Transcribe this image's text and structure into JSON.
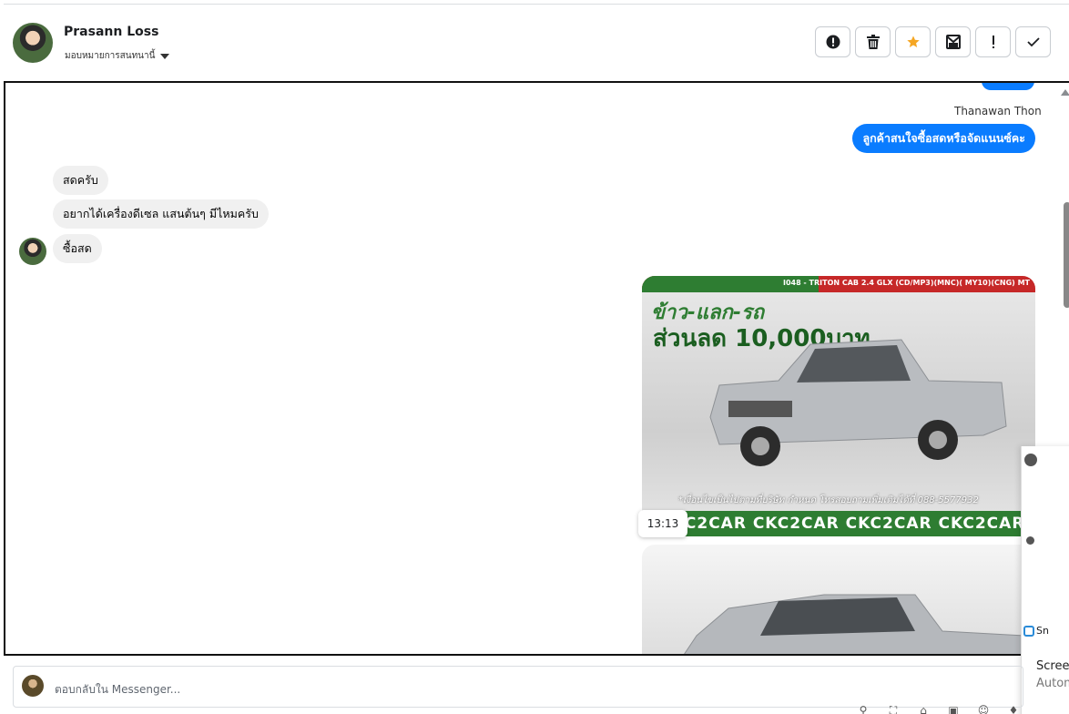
{
  "header": {
    "contact_name": "Prasann Loss",
    "assign_label": "มอบหมายการสนทนานี้",
    "actions": [
      {
        "icon": "alert-circle-icon"
      },
      {
        "icon": "trash-icon"
      },
      {
        "icon": "star-icon"
      },
      {
        "icon": "mark-unread-icon"
      },
      {
        "icon": "exclamation-icon"
      },
      {
        "icon": "check-icon"
      }
    ],
    "star_color": "#f5a623"
  },
  "conversation": {
    "sender_name": "Thanawan Thon",
    "outgoing_message": "ลูกค้าสนใจซื้อสดหรือจัดแนนซ์คะ",
    "incoming_messages": [
      "สดครับ",
      "อยากได้เครื่องดีเซล แสนต้นๆ มีไหมครับ",
      "ซื้อสด"
    ],
    "image_timestamp": "13:13",
    "image": {
      "model_text": "I048 - TRITON CAB 2.4 GLX (CD/MP3)(MNC)( MY10)(CNG) MT",
      "promo_line1": "ข้าว-แลก-รถ",
      "promo_line2": "ส่วนลด 10,000บาท",
      "contact_line": "*เงื่อนไขเป็นไปตามที่บริษัท กำหนด โทรสอบถามเพิ่มเติมได้ที่ 088-5577932",
      "brand_strip": "CKC2CAR CKC2CAR CKC2CAR CKC2CAR CKC"
    },
    "bubble_color_out": "#0a7cff",
    "bubble_color_in": "#f0f0f0"
  },
  "side_panel": {
    "snip_label": "Sn",
    "screen_label": "Screer",
    "auto_label": "Autom"
  },
  "reply": {
    "placeholder": "ตอบกลับใน Messenger..."
  }
}
